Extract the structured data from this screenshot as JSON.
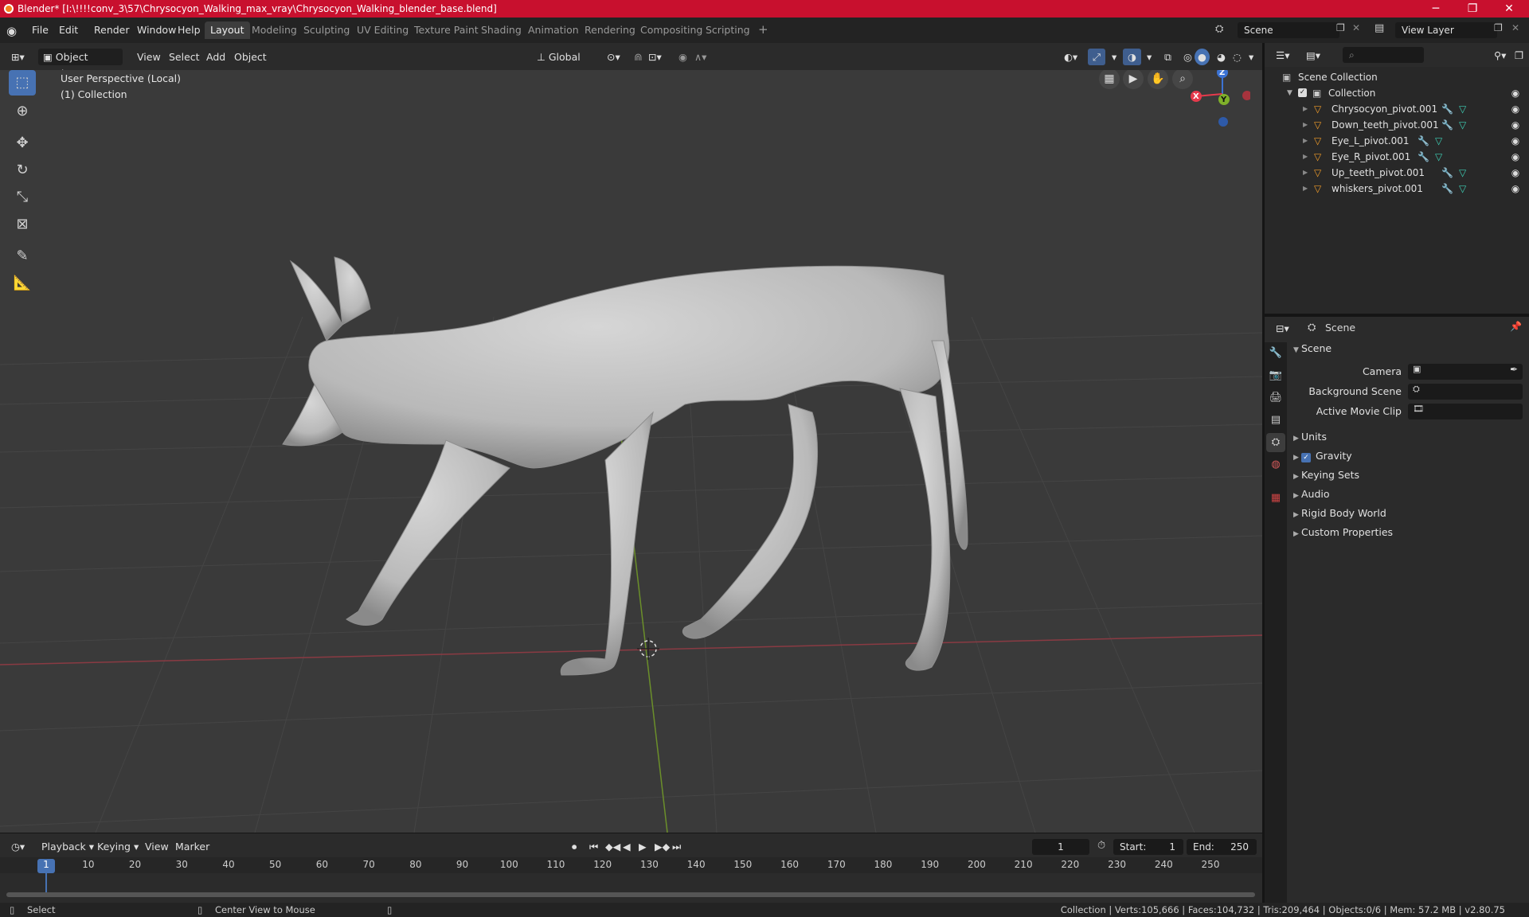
{
  "window": {
    "title": "Blender* [I:\\!!!!conv_3\\57\\Chrysocyon_Walking_max_vray\\Chrysocyon_Walking_blender_base.blend]",
    "minimize": "─",
    "maximize": "❐",
    "close": "✕"
  },
  "menus": [
    "File",
    "Edit",
    "Render",
    "Window",
    "Help"
  ],
  "workspaces": [
    "Layout",
    "Modeling",
    "Sculpting",
    "UV Editing",
    "Texture Paint",
    "Shading",
    "Animation",
    "Rendering",
    "Compositing",
    "Scripting"
  ],
  "active_workspace": "Layout",
  "add_workspace": "+",
  "scene_field": "Scene",
  "view_layer_field": "View Layer",
  "viewport_header": {
    "mode": "Object Mode",
    "menus": [
      "View",
      "Select",
      "Add",
      "Object"
    ],
    "transform_orientation": "Global"
  },
  "viewport": {
    "perspective_label": "User Perspective (Local)",
    "collection_label": "(1) Collection",
    "gizmo": {
      "z": "Z",
      "y": "Y",
      "x": "X"
    }
  },
  "tools": [
    "select-box",
    "cursor",
    "move",
    "rotate",
    "scale",
    "transform",
    "annotate",
    "measure"
  ],
  "outliner": {
    "root": "Scene Collection",
    "collection": "Collection",
    "items": [
      "Chrysocyon_pivot.001",
      "Down_teeth_pivot.001",
      "Eye_L_pivot.001",
      "Eye_R_pivot.001",
      "Up_teeth_pivot.001",
      "whiskers_pivot.001"
    ]
  },
  "properties": {
    "context": "Scene",
    "section": "Scene",
    "camera_label": "Camera",
    "background_scene_label": "Background Scene",
    "active_movie_clip_label": "Active Movie Clip",
    "panels": [
      "Units",
      "Gravity",
      "Keying Sets",
      "Audio",
      "Rigid Body World",
      "Custom Properties"
    ],
    "gravity_checked": true
  },
  "timeline": {
    "menus": [
      "Playback",
      "Keying",
      "View",
      "Marker"
    ],
    "current_frame": "1",
    "start_label": "Start:",
    "start_value": "1",
    "end_label": "End:",
    "end_value": "250",
    "ticks": [
      "1",
      "10",
      "20",
      "30",
      "40",
      "50",
      "60",
      "70",
      "80",
      "90",
      "100",
      "110",
      "120",
      "130",
      "140",
      "150",
      "160",
      "170",
      "180",
      "190",
      "200",
      "210",
      "220",
      "230",
      "240",
      "250"
    ]
  },
  "statusbar": {
    "select": "Select",
    "center_view": "Center View to Mouse",
    "stats": "Collection | Verts:105,666 | Faces:104,732 | Tris:209,464 | Objects:0/6 | Mem: 57.2 MB | v2.80.75"
  },
  "colors": {
    "titlebar": "#c8102e",
    "accent": "#4772b3",
    "x_axis": "#e63a4c",
    "y_axis": "#7fb02a",
    "z_axis": "#3c73d4",
    "object_icon": "#f09c2a",
    "modifier_icon": "#5aa6e8",
    "mesh_icon": "#3ed0b6"
  }
}
